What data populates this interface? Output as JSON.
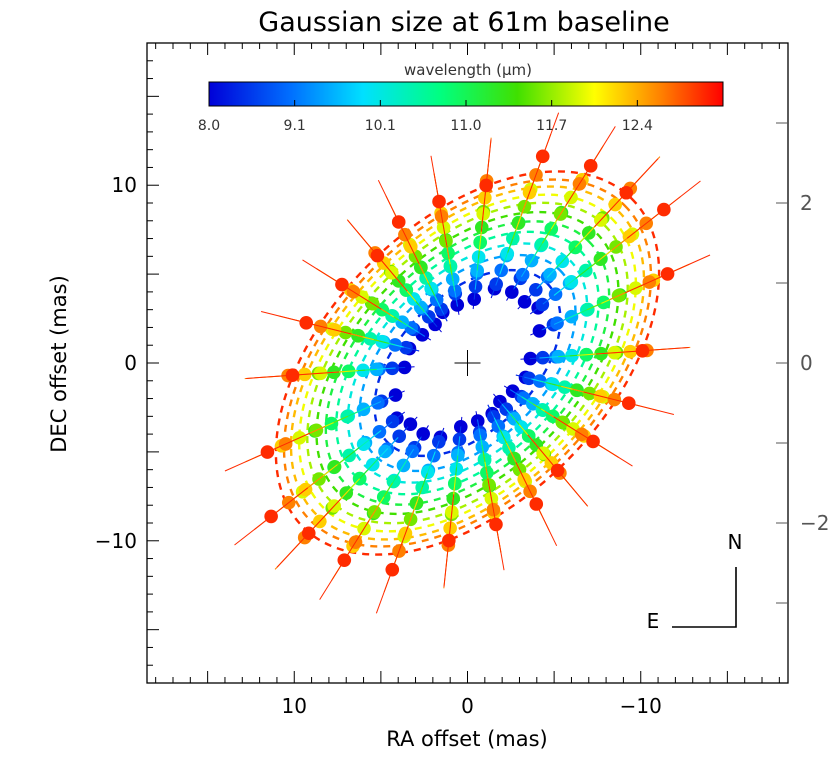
{
  "chart_data": {
    "type": "scatter",
    "title": "Gaussian size at 61m baseline",
    "xlabel": "RA offset (mas)",
    "ylabel": "DEC offset (mas)",
    "xlim": [
      18.5,
      -18.5
    ],
    "ylim": [
      -18,
      18
    ],
    "x_ticks": [
      10,
      0,
      -10
    ],
    "x_tick_labels": [
      "10",
      "0",
      "−10"
    ],
    "y_ticks": [
      -10,
      0,
      10
    ],
    "y_tick_labels": [
      "−10",
      "0",
      "10"
    ],
    "right_axis_ticks": [
      -2,
      0,
      2
    ],
    "right_axis_tick_labels": [
      "−2",
      "0",
      "2"
    ],
    "colorbar": {
      "label": "wavelength (μm)",
      "range": [
        8.0,
        13.0
      ],
      "tick_labels": [
        "8.0",
        "9.1",
        "10.1",
        "11.0",
        "11.7",
        "12.4"
      ]
    },
    "compass": {
      "north": "N",
      "east": "E"
    },
    "ellipse": {
      "position_angle_deg": 45,
      "axis_ratio": 0.6
    },
    "wavelength_rings": [
      {
        "wavelength": 8.3,
        "semi_major": 8.0
      },
      {
        "wavelength": 9.1,
        "semi_major": 9.3
      },
      {
        "wavelength": 9.7,
        "semi_major": 10.3
      },
      {
        "wavelength": 10.1,
        "semi_major": 11.3
      },
      {
        "wavelength": 10.6,
        "semi_major": 12.2
      },
      {
        "wavelength": 11.0,
        "semi_major": 13.0
      },
      {
        "wavelength": 11.4,
        "semi_major": 13.8
      },
      {
        "wavelength": 11.7,
        "semi_major": 14.5
      },
      {
        "wavelength": 12.1,
        "semi_major": 15.2
      },
      {
        "wavelength": 12.4,
        "semi_major": 15.8
      },
      {
        "wavelength": 12.8,
        "semi_major": 16.5
      }
    ],
    "spoke_position_angles_deg": [
      4,
      24,
      38,
      47,
      58,
      70,
      84,
      100,
      116,
      130,
      148,
      166
    ],
    "spoke_wavelengths": [
      8.0,
      8.4,
      8.8,
      9.2,
      9.6,
      10.0,
      10.4,
      10.8,
      11.2,
      11.6,
      12.0,
      12.4,
      12.8
    ],
    "center_marker": "cross",
    "grid": false
  },
  "colors": {
    "background": "#ffffff",
    "axes": "#000000",
    "right_axis": "#555555"
  }
}
